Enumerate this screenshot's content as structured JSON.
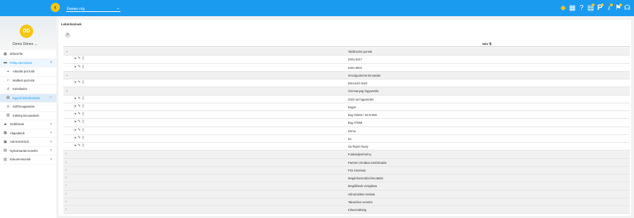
{
  "header": {
    "company": "Ёмомо cég",
    "icons": [
      "tag-icon",
      "dashboard-icon",
      "help-icon",
      "notes-icon",
      "p-icon",
      "bell-icon",
      "flag-icon",
      "headset-icon"
    ]
  },
  "user": {
    "initials": "DD",
    "name": "Demo Dénes"
  },
  "sidebar": {
    "items": [
      {
        "label": "Műszerfal",
        "icon": "dashboard-icon"
      },
      {
        "label": "Flotta elemzések",
        "icon": "car-icon"
      },
      {
        "label": "Aktuális pozíciók",
        "icon": "pin-icon"
      },
      {
        "label": "Múltbeli pozíciók",
        "icon": "history-icon"
      },
      {
        "label": "Kiértékelés",
        "icon": "refresh-icon"
      },
      {
        "label": "Egyedi lekérdezések",
        "icon": "report-icon"
      },
      {
        "label": "Sofőrmagatartás",
        "icon": "steering-icon"
      },
      {
        "label": "Költség kimutatások",
        "icon": "cost-icon"
      },
      {
        "label": "Szállítások",
        "icon": "truck-icon"
      },
      {
        "label": "Alapadatok",
        "icon": "database-icon"
      },
      {
        "label": "Adminisztráció",
        "icon": "admin-icon"
      },
      {
        "label": "Nyilvántartás kezelés",
        "icon": "register-icon"
      },
      {
        "label": "Dokumentumtár",
        "icon": "document-icon"
      }
    ]
  },
  "main": {
    "title": "Lekérdezések",
    "col_name": "Név",
    "rows": [
      {
        "type": "group",
        "open": true,
        "label": "Találkozási pontok"
      },
      {
        "type": "item",
        "label": "0201-0417"
      },
      {
        "type": "item",
        "label": "0401-0501"
      },
      {
        "type": "group",
        "open": true,
        "label": "Országonkénti kimutatás"
      },
      {
        "type": "item",
        "label": "Dimenzió teszt"
      },
      {
        "type": "group",
        "open": true,
        "label": "Üzemanyag fogyasztás"
      },
      {
        "type": "item",
        "label": "2023 üa fogyasztás"
      },
      {
        "type": "item",
        "label": "Bogár"
      },
      {
        "type": "item",
        "label": "Bug #4504 / SCN-650"
      },
      {
        "type": "item",
        "label": "Bug #7959"
      },
      {
        "type": "item",
        "label": "Demo"
      },
      {
        "type": "item",
        "label": "üa"
      },
      {
        "type": "item",
        "label": "Üa Riport havly"
      },
      {
        "type": "group",
        "open": false,
        "label": "Futásteljesítmény"
      },
      {
        "type": "group",
        "open": false,
        "label": "Partnöri zónában tartózkodás"
      },
      {
        "type": "group",
        "open": false,
        "label": "POI érintések"
      },
      {
        "type": "group",
        "open": false,
        "label": "Magánhasználat kimutatás"
      },
      {
        "type": "group",
        "open": false,
        "label": "Megállások vizsgálata"
      },
      {
        "type": "group",
        "open": false,
        "label": "Hőmérséklet értékek"
      },
      {
        "type": "group",
        "open": false,
        "label": "Takarékos vezetés"
      },
      {
        "type": "group",
        "open": false,
        "label": "Kihasználtság"
      }
    ]
  }
}
